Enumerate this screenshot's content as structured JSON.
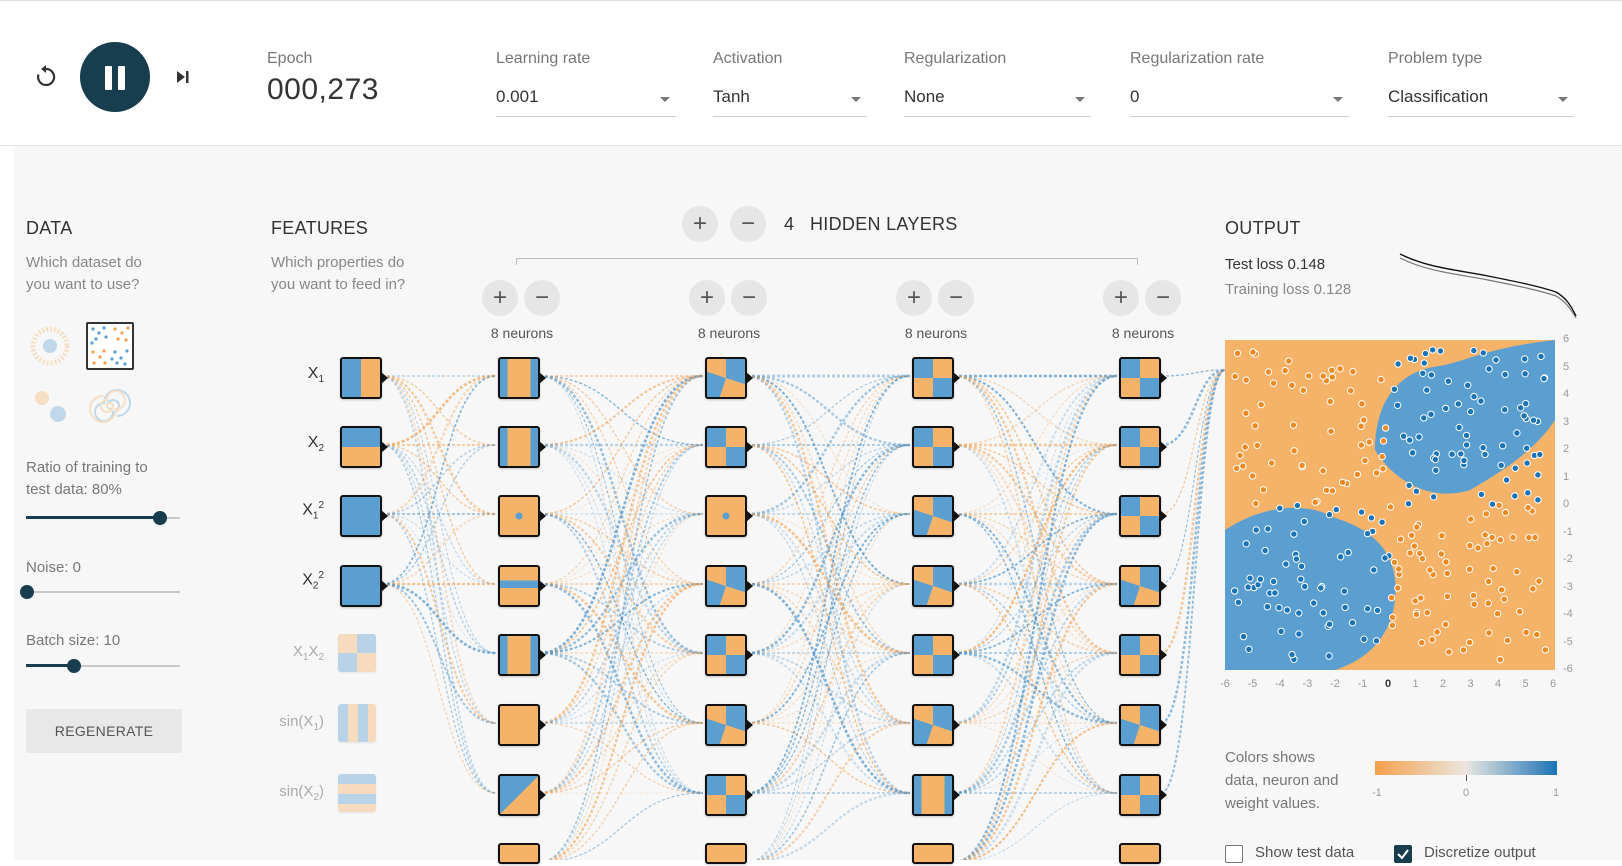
{
  "toolbar": {
    "epoch_label": "Epoch",
    "epoch_value": "000,273",
    "learning_rate": {
      "label": "Learning rate",
      "value": "0.001"
    },
    "activation": {
      "label": "Activation",
      "value": "Tanh"
    },
    "regularization": {
      "label": "Regularization",
      "value": "None"
    },
    "regularization_rate": {
      "label": "Regularization rate",
      "value": "0"
    },
    "problem_type": {
      "label": "Problem type",
      "value": "Classification"
    },
    "icons": {
      "reset": "reset-icon",
      "play_pause": "pause-icon",
      "step": "step-icon"
    }
  },
  "data_panel": {
    "title": "DATA",
    "subtitle": [
      "Which dataset do",
      "you want to use?"
    ],
    "datasets": [
      "circle",
      "xor",
      "gaussian",
      "spiral"
    ],
    "selected_dataset": "xor",
    "ratio_label": [
      "Ratio of training to",
      "test data:  80%"
    ],
    "ratio_value": 80,
    "noise_label": "Noise:  0",
    "noise_value": 0,
    "batch_label": "Batch size:  10",
    "batch_value": 10,
    "regenerate_label": "REGENERATE"
  },
  "features_panel": {
    "title": "FEATURES",
    "subtitle": [
      "Which properties do",
      "you want to feed in?"
    ],
    "features": [
      {
        "base": "X",
        "sub": "1",
        "sup": "",
        "active": true
      },
      {
        "base": "X",
        "sub": "2",
        "sup": "",
        "active": true
      },
      {
        "base": "X",
        "sub": "1",
        "sup": "2",
        "active": true
      },
      {
        "base": "X",
        "sub": "2",
        "sup": "2",
        "active": true
      },
      {
        "base": "X1X2",
        "sub": "",
        "sup": "",
        "active": false
      },
      {
        "base": "sin(X1)",
        "sub": "",
        "sup": "",
        "active": false
      },
      {
        "base": "sin(X2)",
        "sub": "",
        "sup": "",
        "active": false
      }
    ]
  },
  "network": {
    "hidden_layers_count": "4",
    "hidden_layers_label": "HIDDEN LAYERS",
    "layer_neuron_labels": [
      "8 neurons",
      "8 neurons",
      "8 neurons",
      "8 neurons"
    ]
  },
  "output_panel": {
    "title": "OUTPUT",
    "test_loss": "Test loss 0.148",
    "training_loss": "Training loss 0.128",
    "y_ticks": [
      "6",
      "5",
      "4",
      "3",
      "2",
      "1",
      "0",
      "-1",
      "-2",
      "-3",
      "-4",
      "-5",
      "-6"
    ],
    "x_ticks": [
      "-6",
      "-5",
      "-4",
      "-3",
      "-2",
      "-1",
      "0",
      "1",
      "2",
      "3",
      "4",
      "5",
      "6"
    ],
    "legend_text": [
      "Colors shows",
      "data, neuron and",
      "weight values."
    ],
    "legend_ticks": [
      "-1",
      "0",
      "1"
    ],
    "show_test_data": {
      "label": "Show test data",
      "checked": false
    },
    "discretize_output": {
      "label": "Discretize output",
      "checked": true
    }
  },
  "colors": {
    "orange": "#f5b36a",
    "blue": "#5b9fd0",
    "dark": "#183d4e"
  }
}
